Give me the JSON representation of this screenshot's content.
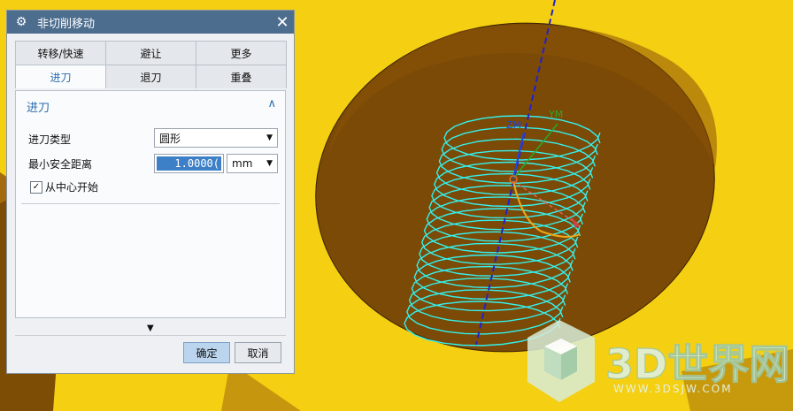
{
  "dialog": {
    "title": "非切削移动",
    "tabs_row1": [
      "转移/快速",
      "避让",
      "更多"
    ],
    "tabs_row2": [
      "进刀",
      "退刀",
      "重叠"
    ],
    "active_tab": "进刀",
    "section_title": "进刀",
    "fields": {
      "engage_type_label": "进刀类型",
      "engage_type_value": "圆形",
      "min_clearance_label": "最小安全距离",
      "min_clearance_value": "1.0000(",
      "unit_value": "mm",
      "from_center_label": "从中心开始",
      "from_center_checked": true
    },
    "buttons": {
      "ok": "确定",
      "cancel": "取消"
    }
  },
  "viewport": {
    "axis_labels": {
      "ym": "YM",
      "zm": "ZM"
    },
    "colors": {
      "background": "#f5cf12",
      "toolpath": "#35f0ee",
      "hole": "#7a4a06",
      "axis": "#2222cc"
    }
  },
  "watermark": {
    "brand": "3D世界网",
    "url": "WWW.3DSJW.COM"
  }
}
